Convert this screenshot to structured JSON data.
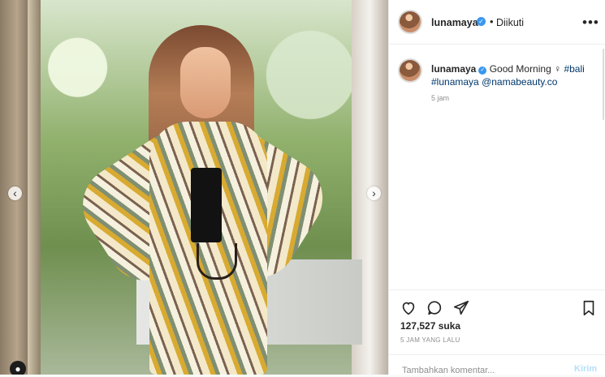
{
  "profile": {
    "username": "lunamaya",
    "follow_status": "Diikuti"
  },
  "post": {
    "caption_username": "lunamaya",
    "caption": "Good Morning",
    "emoji": "♀",
    "hashtags": [
      "#bali",
      "#lunamaya",
      "@namabeauty.co"
    ],
    "time": "5 jam",
    "likes": "127,527 suka",
    "time_ago": "5 JAM YANG LALU"
  },
  "comment_box": {
    "placeholder": "Tambahkan komentar...",
    "post_label": "Kirim"
  },
  "icons": {
    "verified": "verified-icon",
    "more": "more-icon",
    "like": "heart-icon",
    "comment": "comment-icon",
    "share": "share-icon",
    "save": "bookmark-icon",
    "prev": "chevron-left-icon",
    "next": "chevron-right-icon",
    "user_tag": "user-tag-icon"
  },
  "colors": {
    "verified": "#3897f0",
    "link": "#00376b",
    "border": "#efefef",
    "secondary_text": "#8e8e8e"
  }
}
